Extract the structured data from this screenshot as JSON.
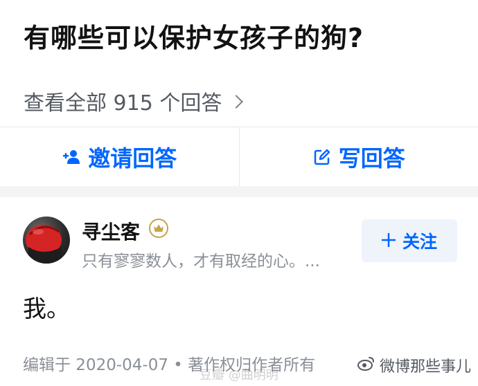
{
  "question": {
    "title": "有哪些可以保护女孩子的狗?",
    "view_all": "查看全部 915 个回答"
  },
  "actions": {
    "invite_label": "邀请回答",
    "write_label": "写回答"
  },
  "answer": {
    "author_name": "寻尘客",
    "author_bio": "只有寥寥数人，才有取经的心。...",
    "follow_label": "关注",
    "content": "我。",
    "meta": "编辑于 2020-04-07 • 著作权归作者所有"
  },
  "watermarks": {
    "center": "豆瓣 @曲明明",
    "corner": "微博那些事儿"
  },
  "colors": {
    "accent": "#0066ff",
    "text": "#121212",
    "secondary": "#8a8f97",
    "badge_gold": "#c7a24a"
  },
  "icons": {
    "view_all": "chevron-right-icon",
    "invite": "add-user-icon",
    "write": "edit-icon",
    "badge": "crown-icon",
    "follow": "plus-icon",
    "corner_watermark": "weibo-logo-icon"
  }
}
